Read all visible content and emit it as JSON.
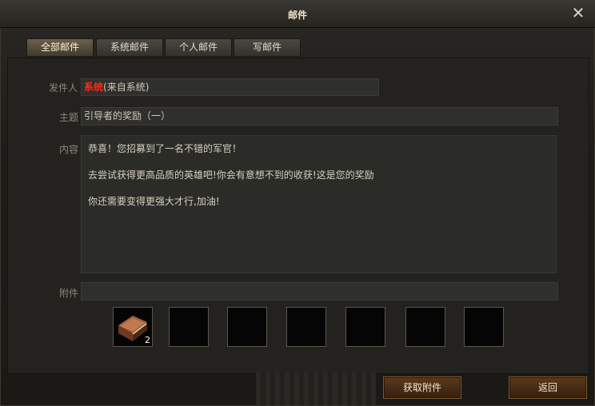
{
  "window": {
    "title": "邮件"
  },
  "tabs": [
    {
      "label": "全部邮件",
      "active": true
    },
    {
      "label": "系统邮件",
      "active": false
    },
    {
      "label": "个人邮件",
      "active": false
    },
    {
      "label": "写邮件",
      "active": false
    }
  ],
  "mail": {
    "sender_label": "发件人",
    "sender_name": "系统",
    "sender_suffix": "(来自系统)",
    "subject_label": "主题",
    "subject": "引导者的奖励（一）",
    "content_label": "内容",
    "content_lines": [
      "恭喜！您招募到了一名不错的军官！",
      "去尝试获得更高品质的英雄吧!你会有意想不到的收获!这是您的奖励",
      "你还需要变得更强大才行,加油!"
    ],
    "attachment_label": "附件",
    "attachment_value": ""
  },
  "attachments": [
    {
      "icon": "book-icon",
      "count": "2"
    },
    {
      "icon": "",
      "count": ""
    },
    {
      "icon": "",
      "count": ""
    },
    {
      "icon": "",
      "count": ""
    },
    {
      "icon": "",
      "count": ""
    },
    {
      "icon": "",
      "count": ""
    },
    {
      "icon": "",
      "count": ""
    }
  ],
  "buttons": {
    "get_attachment": "获取附件",
    "back": "返回"
  },
  "colors": {
    "sender_highlight": "#ff2a1a",
    "button_bg": "#4a2e16"
  }
}
